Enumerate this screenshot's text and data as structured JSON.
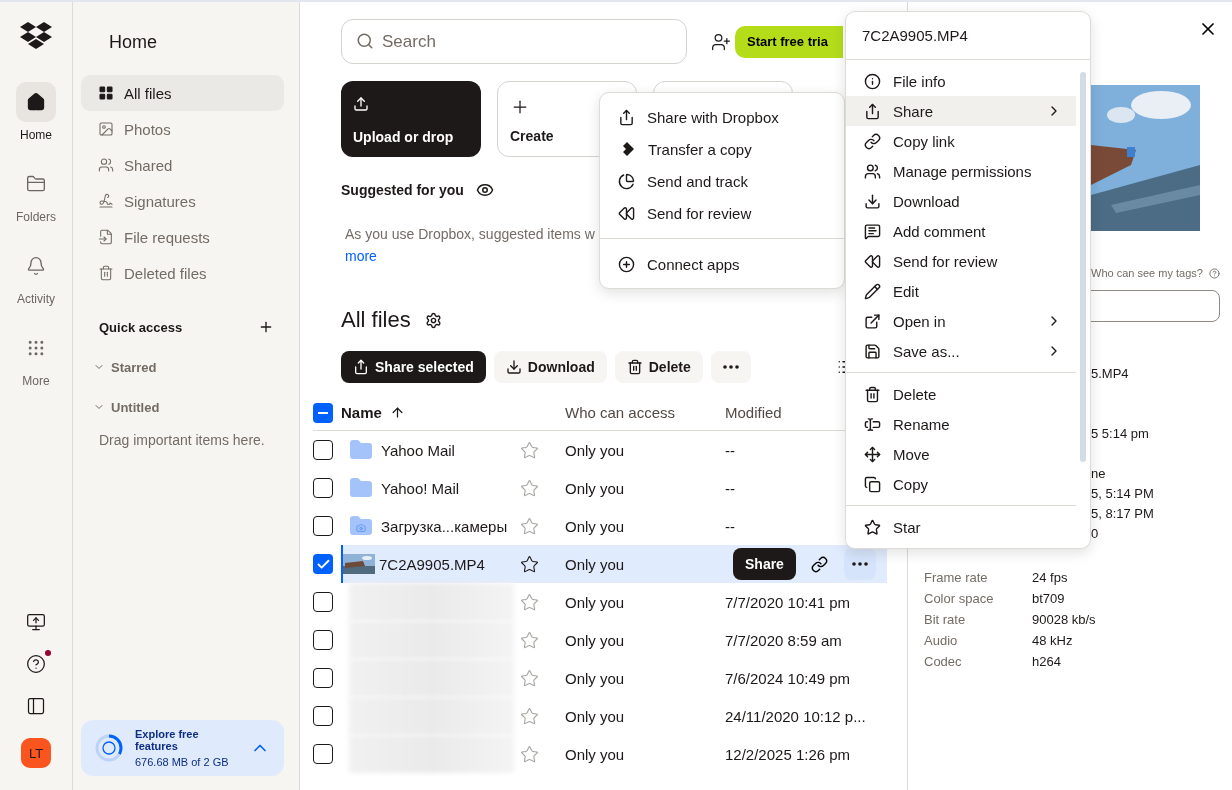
{
  "rail": {
    "items": [
      {
        "label": "Home",
        "selected": true
      },
      {
        "label": "Folders",
        "selected": false
      },
      {
        "label": "Activity",
        "selected": false
      },
      {
        "label": "More",
        "selected": false
      }
    ],
    "help_badge": true,
    "avatar": "LT"
  },
  "sidebar": {
    "title": "Home",
    "items": [
      {
        "label": "All files",
        "selected": true
      },
      {
        "label": "Photos",
        "selected": false
      },
      {
        "label": "Shared",
        "selected": false
      },
      {
        "label": "Signatures",
        "selected": false
      },
      {
        "label": "File requests",
        "selected": false
      },
      {
        "label": "Deleted files",
        "selected": false
      }
    ],
    "quick_access": "Quick access",
    "sections": [
      {
        "label": "Starred",
        "expanded": true
      },
      {
        "label": "Untitled",
        "expanded": true
      }
    ],
    "hint": "Drag important items here.",
    "storage": {
      "title": "Explore free features",
      "usage": "676.68 MB of 2 GB",
      "level": 0.33
    }
  },
  "top": {
    "search": {
      "placeholder": "Search"
    },
    "trial_button": "Start free tria"
  },
  "cards": [
    {
      "label": "Upload or drop",
      "kind": "upload"
    },
    {
      "label": "Create",
      "kind": "create"
    },
    {
      "kind": "blank"
    }
  ],
  "suggested": {
    "title": "Suggested for you",
    "text": "As you use Dropbox, suggested items w",
    "link": "more"
  },
  "files": {
    "title": "All files",
    "actions": [
      "Share selected",
      "Download",
      "Delete"
    ],
    "columns": [
      "Name",
      "Who can access",
      "Modified"
    ],
    "select_all_indeterminate": true,
    "rows": [
      {
        "kind": "folder",
        "name": "Yahoo Mail",
        "access": "Only you",
        "modified": "--",
        "checked": false,
        "selected": false
      },
      {
        "kind": "folder",
        "name": "Yahoo! Mail",
        "access": "Only you",
        "modified": "--",
        "checked": false,
        "selected": false
      },
      {
        "kind": "camera-folder",
        "name": "Загрузка...камеры",
        "access": "Only you",
        "modified": "--",
        "checked": false,
        "selected": false
      },
      {
        "kind": "video",
        "name": "7C2A9905.MP4",
        "access": "Only you",
        "checked": true,
        "selected": true,
        "share": "Share"
      },
      {
        "kind": "blurred",
        "access": "Only you",
        "modified": "7/7/2020 10:41 pm",
        "checked": false,
        "selected": false
      },
      {
        "kind": "blurred",
        "access": "Only you",
        "modified": "7/7/2020 8:59 am",
        "checked": false,
        "selected": false
      },
      {
        "kind": "blurred",
        "access": "Only you",
        "modified": "7/6/2024 10:49 pm",
        "checked": false,
        "selected": false
      },
      {
        "kind": "blurred",
        "access": "Only you",
        "modified": "24/11/2020 10:12 p...",
        "checked": false,
        "selected": false
      },
      {
        "kind": "blurred",
        "access": "Only you",
        "modified": "12/2/2025 1:26 pm",
        "checked": false,
        "selected": false
      }
    ]
  },
  "details": {
    "tags_help": "Who can see my tags?",
    "partial_values": [
      "5.MP4",
      "5 5:14 pm",
      "ne",
      "5, 5:14 PM",
      "5, 8:17 PM",
      "0"
    ],
    "rows": [
      {
        "label": "Frame rate",
        "value": "24 fps"
      },
      {
        "label": "Color space",
        "value": "bt709"
      },
      {
        "label": "Bit rate",
        "value": "90028 kb/s"
      },
      {
        "label": "Audio",
        "value": "48 kHz"
      },
      {
        "label": "Codec",
        "value": "h264"
      }
    ]
  },
  "share_menu": {
    "items": [
      {
        "kind": "item",
        "label": "Share with Dropbox"
      },
      {
        "kind": "item",
        "label": "Transfer a copy"
      },
      {
        "kind": "item",
        "label": "Send and track"
      },
      {
        "kind": "item",
        "label": "Send for review"
      },
      {
        "kind": "separator"
      },
      {
        "kind": "item",
        "label": "Connect apps"
      }
    ]
  },
  "context_menu": {
    "title": "7C2A9905.MP4",
    "items": [
      {
        "kind": "item",
        "label": "File info",
        "submenu": false,
        "highlighted": false
      },
      {
        "kind": "item",
        "label": "Share",
        "submenu": true,
        "highlighted": true
      },
      {
        "kind": "item",
        "label": "Copy link",
        "submenu": false,
        "highlighted": false
      },
      {
        "kind": "item",
        "label": "Manage permissions",
        "submenu": false,
        "highlighted": false
      },
      {
        "kind": "item",
        "label": "Download",
        "submenu": false,
        "highlighted": false
      },
      {
        "kind": "item",
        "label": "Add comment",
        "submenu": false,
        "highlighted": false
      },
      {
        "kind": "item",
        "label": "Send for review",
        "submenu": false,
        "highlighted": false
      },
      {
        "kind": "item",
        "label": "Edit",
        "submenu": false,
        "highlighted": false
      },
      {
        "kind": "item",
        "label": "Open in",
        "submenu": true,
        "highlighted": false
      },
      {
        "kind": "item",
        "label": "Save as...",
        "submenu": true,
        "highlighted": false
      },
      {
        "kind": "separator"
      },
      {
        "kind": "item",
        "label": "Delete",
        "submenu": false,
        "highlighted": false
      },
      {
        "kind": "item",
        "label": "Rename",
        "submenu": false,
        "highlighted": false
      },
      {
        "kind": "item",
        "label": "Move",
        "submenu": false,
        "highlighted": false
      },
      {
        "kind": "item",
        "label": "Copy",
        "submenu": false,
        "highlighted": false
      },
      {
        "kind": "separator"
      },
      {
        "kind": "item",
        "label": "Star",
        "submenu": false,
        "highlighted": false
      }
    ]
  }
}
